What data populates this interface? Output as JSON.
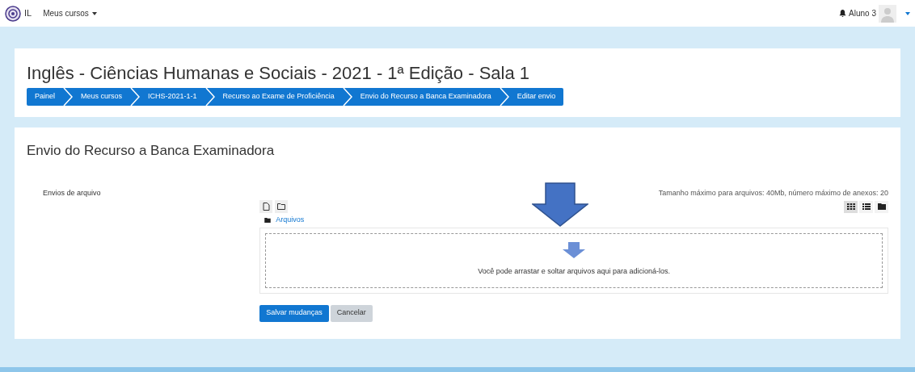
{
  "navbar": {
    "logo_text": "IL",
    "menu": "Meus cursos",
    "user": "Aluno 3"
  },
  "header": {
    "title": "Inglês - Ciências Humanas e Sociais - 2021 - 1ª Edição - Sala 1",
    "breadcrumbs": [
      "Painel",
      "Meus cursos",
      "ICHS-2021-1-1",
      "Recurso ao Exame de Proficiência",
      "Envio do Recurso a Banca Examinadora",
      "Editar envio"
    ]
  },
  "content": {
    "heading": "Envio do Recurso a Banca Examinadora",
    "field_label": "Envios de arquivo",
    "limits": "Tamanho máximo para arquivos: 40Mb, número máximo de anexos: 20",
    "view_modes": [
      {
        "kind": "grid",
        "selected": true
      },
      {
        "kind": "list",
        "selected": false
      },
      {
        "kind": "tree",
        "selected": false
      }
    ],
    "folder": "Arquivos",
    "dropzone_text": "Você pode arrastar e soltar arquivos aqui para adicioná-los.",
    "buttons": [
      {
        "label": "Salvar mudanças",
        "kind": "primary"
      },
      {
        "label": "Cancelar",
        "kind": "secondary"
      }
    ]
  }
}
